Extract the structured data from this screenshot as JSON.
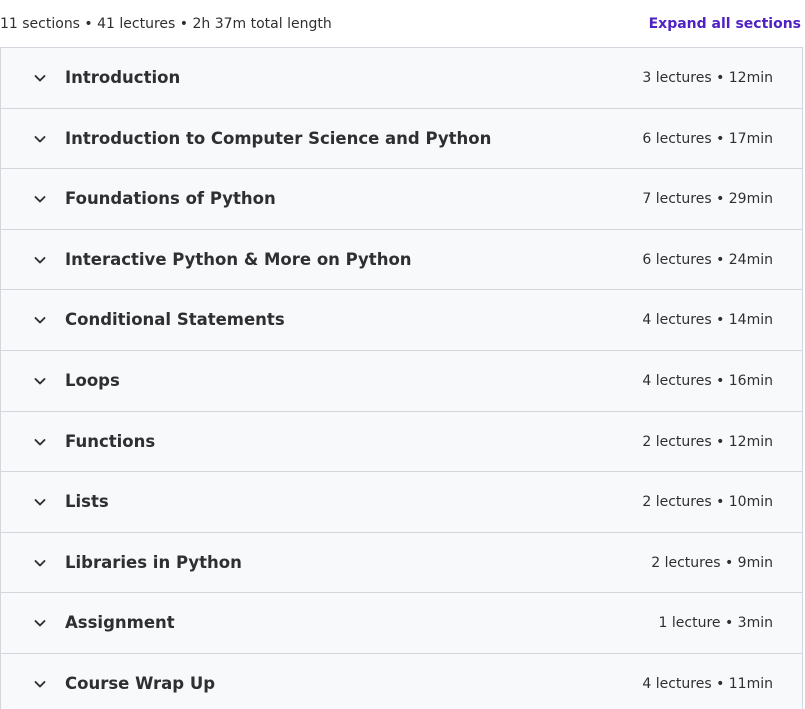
{
  "summary": {
    "text": "11 sections • 41 lectures • 2h 37m total length",
    "expand_label": "Expand all sections"
  },
  "colors": {
    "accent": "#5022c3",
    "row_background": "#f7f9fa",
    "border": "#d1d7dc",
    "text": "#2d2f31"
  },
  "icons": {
    "section_toggle": "chevron-down-icon"
  },
  "sections": [
    {
      "title": "Introduction",
      "meta": "3 lectures • 12min"
    },
    {
      "title": "Introduction to Computer Science and Python",
      "meta": "6 lectures • 17min"
    },
    {
      "title": "Foundations of Python",
      "meta": "7 lectures • 29min"
    },
    {
      "title": "Interactive Python & More on Python",
      "meta": "6 lectures • 24min"
    },
    {
      "title": "Conditional Statements",
      "meta": "4 lectures • 14min"
    },
    {
      "title": "Loops",
      "meta": "4 lectures • 16min"
    },
    {
      "title": "Functions",
      "meta": "2 lectures • 12min"
    },
    {
      "title": "Lists",
      "meta": "2 lectures • 10min"
    },
    {
      "title": "Libraries in Python",
      "meta": "2 lectures • 9min"
    },
    {
      "title": "Assignment",
      "meta": "1 lecture • 3min"
    },
    {
      "title": "Course Wrap Up",
      "meta": "4 lectures • 11min"
    }
  ]
}
